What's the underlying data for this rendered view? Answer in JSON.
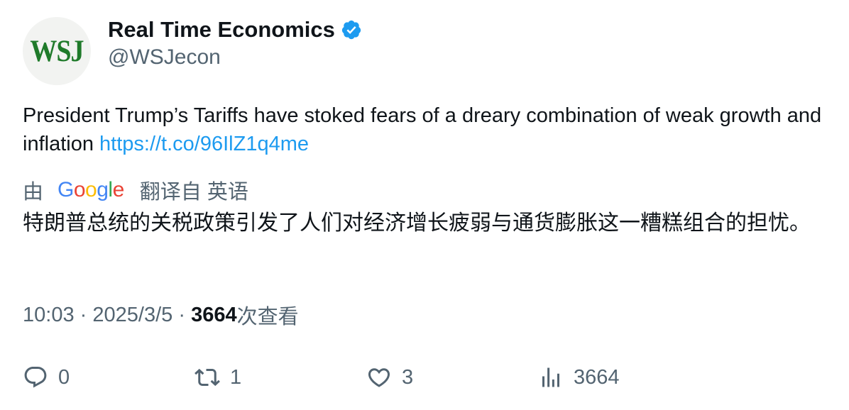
{
  "author": {
    "avatar_text": "WSJ",
    "display_name": "Real Time Economics",
    "handle": "@WSJecon",
    "verified": true
  },
  "tweet": {
    "text": "President Trump’s Tariffs have stoked fears of a dreary combination of weak growth and inflation ",
    "link": "https://t.co/96IlZ1q4me"
  },
  "translation": {
    "prefix": "由",
    "suffix": "翻译自 英语",
    "text": "特朗普总统的关税政策引发了人们对经济增长疲弱与通货膨胀这一糟糕组合的担忧。"
  },
  "meta": {
    "time": "10:03",
    "separator": "·",
    "date": "2025/3/5",
    "views": "3664",
    "views_label": "次查看"
  },
  "actions": {
    "replies": "0",
    "retweets": "1",
    "likes": "3",
    "views": "3664"
  },
  "colors": {
    "link": "#1d9bf0",
    "muted": "#536471",
    "text": "#0f1419",
    "verified": "#1d9bf0",
    "wsj_green": "#1f7a2a"
  },
  "icons": [
    "verified-badge-icon",
    "reply-icon",
    "retweet-icon",
    "like-icon",
    "views-icon"
  ]
}
